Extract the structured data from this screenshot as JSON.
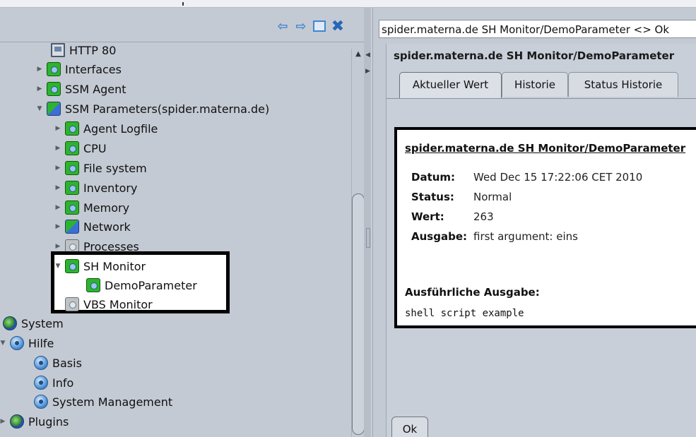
{
  "tree": {
    "http80": "HTTP 80",
    "interfaces": "Interfaces",
    "ssm_agent": "SSM Agent",
    "ssm_parameters": "SSM Parameters(spider.materna.de)",
    "agent_logfile": "Agent Logfile",
    "cpu": "CPU",
    "file_system": "File system",
    "inventory": "Inventory",
    "memory": "Memory",
    "network": "Network",
    "processes": "Processes",
    "sh_monitor": "SH Monitor",
    "demo_parameter": "DemoParameter",
    "vbs_monitor": "VBS Monitor",
    "system": "System",
    "hilfe": "Hilfe",
    "basis": "Basis",
    "info": "Info",
    "system_management": "System Management",
    "plugins": "Plugins"
  },
  "right": {
    "path": "spider.materna.de SH Monitor/DemoParameter <> Ok",
    "title": "spider.materna.de SH Monitor/DemoParameter",
    "tabs": [
      "Aktueller Wert",
      "Historie",
      "Status Historie"
    ],
    "detail": {
      "title": "spider.materna.de SH Monitor/DemoParameter",
      "datum_label": "Datum:",
      "datum_value": "Wed Dec 15 17:22:06 CET 2010",
      "status_label": "Status:",
      "status_value": "Normal",
      "wert_label": "Wert:",
      "wert_value": "263",
      "ausgabe_label": "Ausgabe:",
      "ausgabe_value": "first argument: eins",
      "long_label": "Ausführliche Ausgabe:",
      "long_value": "shell script example"
    },
    "ok_button": "Ok"
  },
  "toolbar": {
    "back_icon": "arrow-left-icon",
    "forward_icon": "arrow-right-icon",
    "maximize_icon": "window-icon",
    "close_icon": "close-icon"
  },
  "colors": {
    "accent": "#3f86cf",
    "status_ok": "#2eb32e",
    "background": "#c4cad3"
  }
}
